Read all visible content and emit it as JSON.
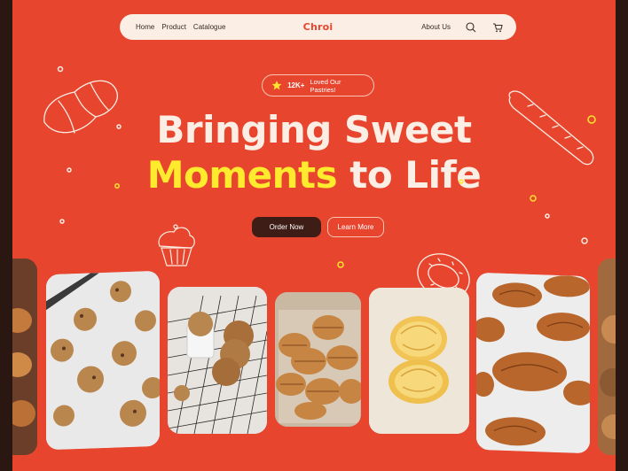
{
  "nav": {
    "links": [
      "Home",
      "Product",
      "Catalogue"
    ],
    "logo": "Chroi",
    "about": "About Us",
    "search_icon": "search-icon",
    "cart_icon": "cart-icon"
  },
  "badge": {
    "icon": "star-icon",
    "count": "12K+",
    "text": "Loved Our Pastries!"
  },
  "hero": {
    "line1": "Bringing Sweet",
    "line2_highlight": "Moments",
    "line2_rest": "to Life"
  },
  "buttons": {
    "order": "Order Now",
    "learn": "Learn More"
  },
  "colors": {
    "background": "#e8452f",
    "nav_bg": "#fbeee4",
    "highlight": "#ffeb2e",
    "dark_button": "#3e1d17"
  },
  "gallery": [
    "cookies-tray",
    "cookies-jar-rack",
    "croissant-box",
    "croissant-cross-section",
    "croissants-tray"
  ]
}
